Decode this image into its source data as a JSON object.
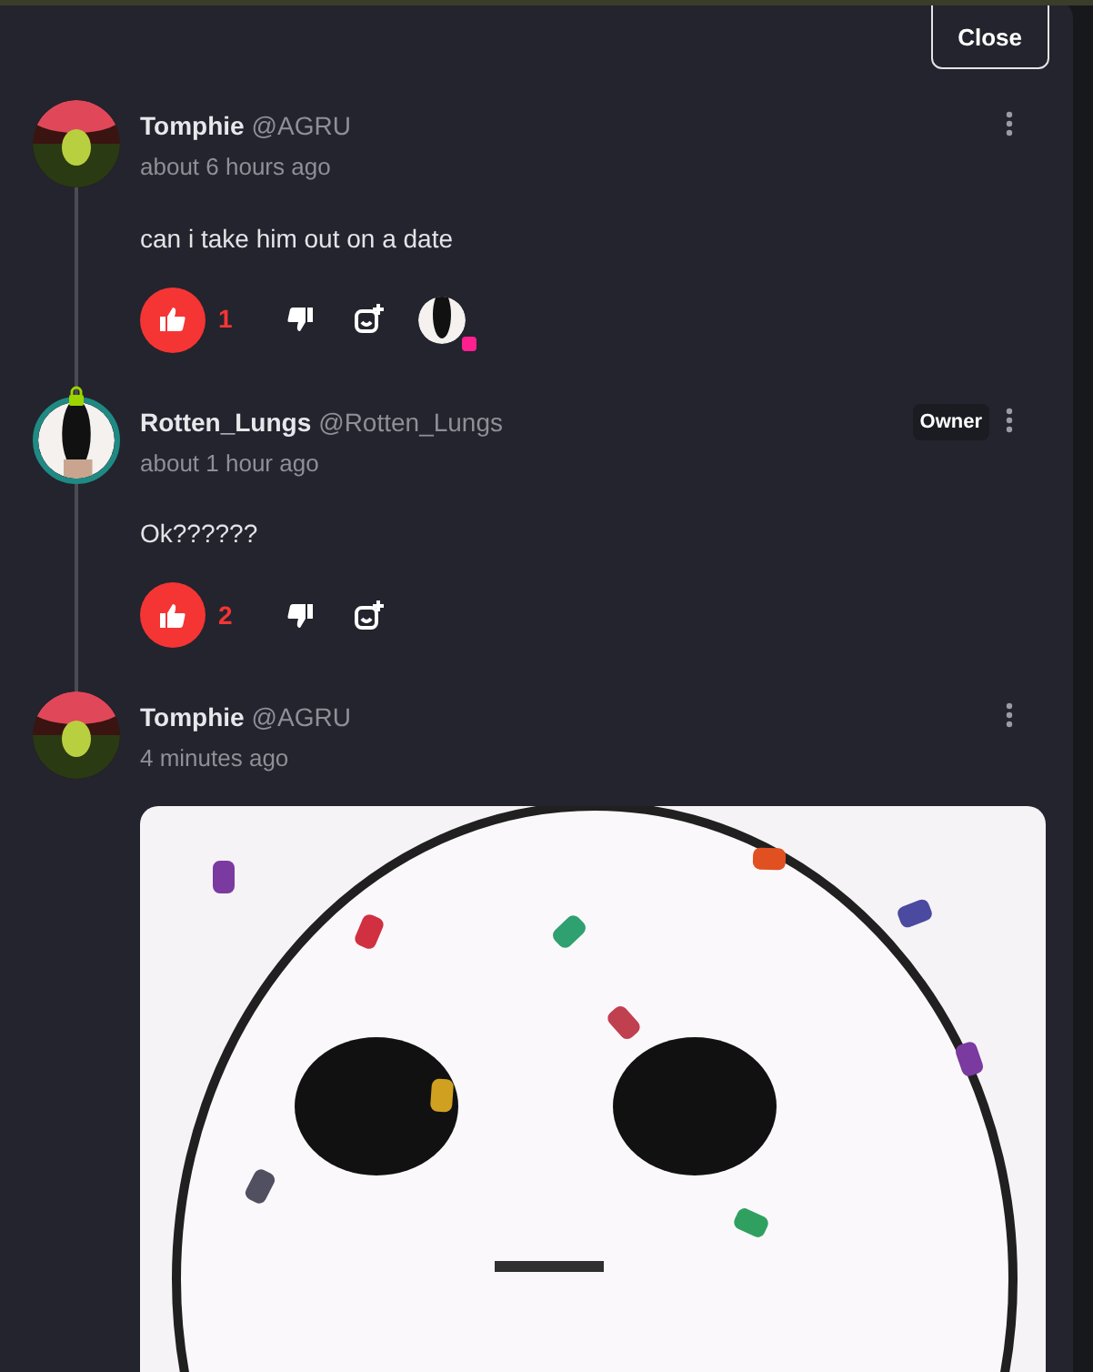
{
  "close_button": "Close",
  "comments": [
    {
      "name": "Tomphie",
      "handle": "@AGRU",
      "time": "about 6 hours ago",
      "text": "can i take him out on a date",
      "avatar": {
        "kind": "green",
        "framed": false
      },
      "likes": "1",
      "liked": true,
      "reactors": [
        {
          "color": "#ff1f8f"
        }
      ]
    },
    {
      "name": "Rotten_Lungs",
      "handle": "@Rotten_Lungs",
      "time": "about 1 hour ago",
      "badge": "Owner",
      "text": "Ok??????",
      "avatar": {
        "kind": "dark",
        "framed": true
      },
      "likes": "2",
      "liked": true
    },
    {
      "name": "Tomphie",
      "handle": "@AGRU",
      "time": "4 minutes ago",
      "avatar": {
        "kind": "green",
        "framed": false
      }
    }
  ]
}
